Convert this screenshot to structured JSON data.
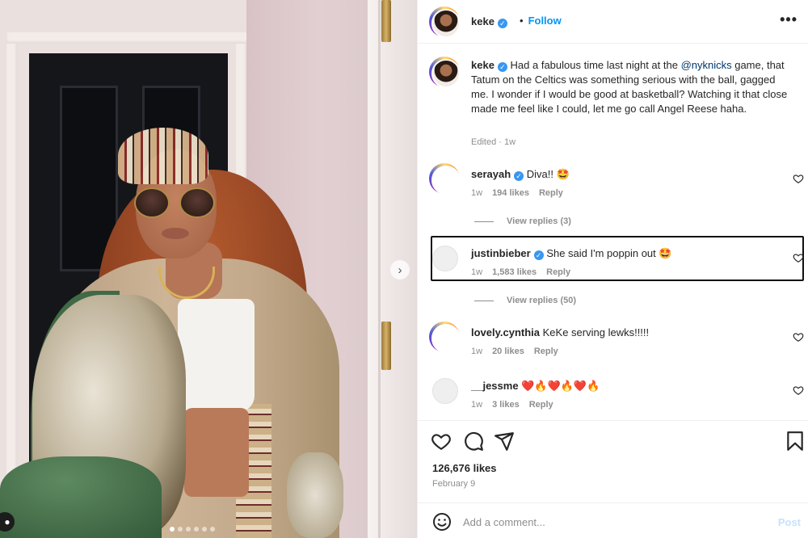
{
  "post": {
    "username": "keke",
    "follow_separator": "•",
    "follow_label": "Follow",
    "more_label": "•••",
    "caption_before_mention": " Had a fabulous time last night at the ",
    "mention": "@nyknicks",
    "caption_after_mention": " game, that Tatum on the Celtics was something serious with the ball, gagged me. I wonder if I would be good at basketball? Watching it that close made me feel like I could, let me go call Angel Reese haha.",
    "caption_meta": "Edited · 1w",
    "likes": "126,676 likes",
    "date": "February 9",
    "add_comment_placeholder": "Add a comment...",
    "post_label": "Post"
  },
  "comments": [
    {
      "username": "serayah",
      "verified": true,
      "text": "Diva!! 🤩",
      "age": "1w",
      "likes": "194 likes",
      "reply": "Reply",
      "replies": "View replies (3)"
    },
    {
      "username": "justinbieber",
      "verified": true,
      "text": "She said I'm poppin out 🤩",
      "age": "1w",
      "likes": "1,583 likes",
      "reply": "Reply",
      "replies": "View replies (50)"
    },
    {
      "username": "lovely.cynthia",
      "verified": false,
      "text": "KeKe serving lewks!!!!!",
      "age": "1w",
      "likes": "20 likes",
      "reply": "Reply"
    },
    {
      "username": "__jessme",
      "verified": false,
      "text": "❤️🔥❤️🔥❤️🔥",
      "age": "1w",
      "likes": "3 likes",
      "reply": "Reply"
    }
  ],
  "carousel": {
    "total": 6,
    "active": 0
  },
  "colors": {
    "link": "#0095f6",
    "mention": "#00376b",
    "muted": "#8e8e8e",
    "verified": "#3897f0"
  },
  "icons": [
    "heart-icon",
    "comment-icon",
    "share-icon",
    "bookmark-icon",
    "smile-icon",
    "chevron-right-icon",
    "verified-icon",
    "more-icon"
  ]
}
